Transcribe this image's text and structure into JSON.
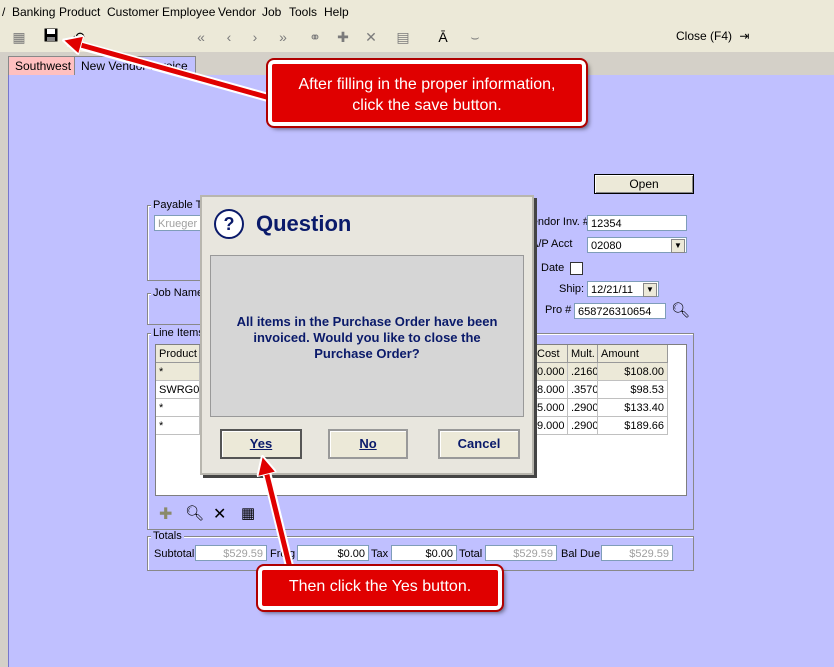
{
  "menu": [
    "Banking",
    "Product",
    "Customer",
    "Employee",
    "Vendor",
    "Job",
    "Tools",
    "Help"
  ],
  "toolbar": {
    "close_label": "Close (F4)"
  },
  "tabs": [
    "Southwest",
    "New Vendor Invoice"
  ],
  "form": {
    "open_button": "Open",
    "payable_to_label": "Payable T",
    "payable_to_value": "Krueger",
    "job_name_label": "Job Name",
    "vendor_inv_label": "Vendor Inv. #",
    "vendor_inv_value": "12354",
    "ap_acct_label": "A/P Acct",
    "ap_acct_value": "02080",
    "date_label": "Date",
    "ship_label": "Ship:",
    "ship_value": "12/21/11",
    "pro_label": "Pro #",
    "pro_value": "658726310654"
  },
  "line_items": {
    "label": "Line Items",
    "headers": [
      "Product",
      "Cost Ea",
      "Mult.",
      "Amount"
    ],
    "rows": [
      [
        "*",
        "0.000",
        ".2160",
        "$108.00"
      ],
      [
        "SWRG0",
        "8.000",
        ".3570",
        "$98.53"
      ],
      [
        "*",
        "5.000",
        ".2900",
        "$133.40"
      ],
      [
        "*",
        "9.000",
        ".2900",
        "$189.66"
      ]
    ]
  },
  "totals": {
    "label": "Totals",
    "subtotal_label": "Subtotal",
    "subtotal_value": "$529.59",
    "freight_label": "Freig",
    "freight_value": "$0.00",
    "tax_label": "Tax",
    "tax_value": "$0.00",
    "total_label": "Total",
    "total_value": "$529.59",
    "bal_due_label": "Bal Due",
    "bal_due_value": "$529.59"
  },
  "dialog": {
    "title": "Question",
    "message": "All items in the Purchase Order have been invoiced.  Would you like to close the Purchase Order?",
    "yes": "Yes",
    "no": "No",
    "cancel": "Cancel"
  },
  "callouts": {
    "save": "After filling in the proper information, click the save button.",
    "yes": "Then click the Yes button."
  },
  "colors": {
    "main_bg": "#c0c0ff",
    "callout": "#e00000",
    "dialog_title": "#0a1a6a"
  }
}
